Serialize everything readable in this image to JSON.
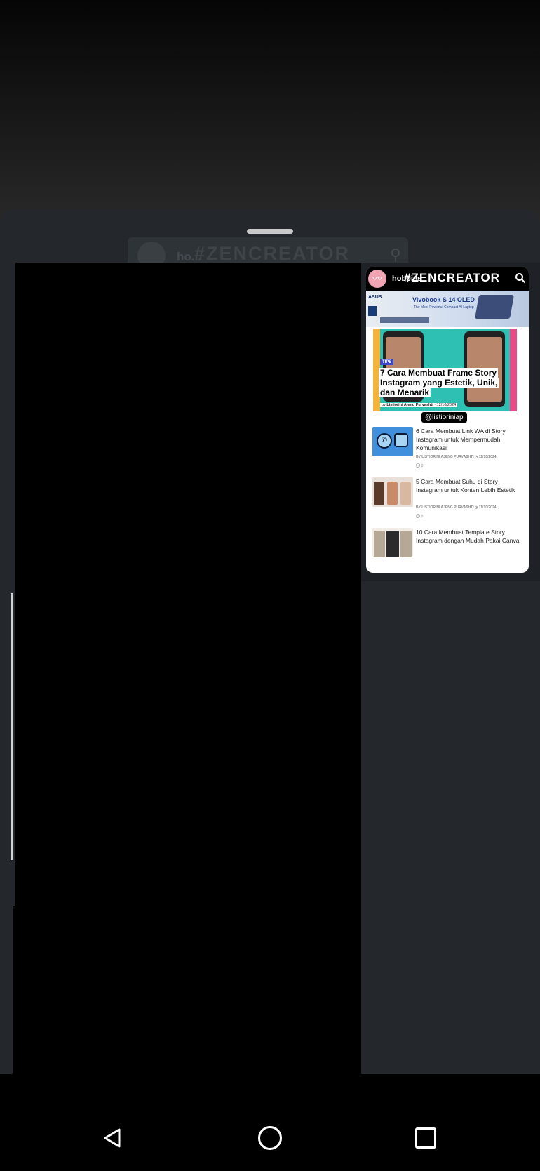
{
  "background": {
    "top_color": "#050505",
    "sheet_color": "#24282c"
  },
  "ghost_header": {
    "handle": "ho...",
    "title": "#ZENCREATOR"
  },
  "story": {
    "handle": "hobbies",
    "title": "#ZENCREATOR",
    "avatar_color": "#f1a4b4",
    "ad": {
      "brand": "ASUS",
      "title": "Vivobook S 14 OLED",
      "subtitle": "The Most Powerful Compact AI Laptop"
    },
    "hero": {
      "tag": "TIPS",
      "headline": "7 Cara Membuat Frame Story Instagram yang Estetik, Unik, dan Menarik",
      "author_prefix": "by",
      "author": "Listiorini Ajeng Purvashti",
      "date": "12/10/2024"
    },
    "mention": "@listioriniap",
    "articles": [
      {
        "title": "6 Cara Membuat Link WA di Story Instagram untuk Mempermudah Komunikasi",
        "byline": "BY LISTIORINI AJENG PURVASHTI",
        "date": "11/10/2024",
        "comments": "0"
      },
      {
        "title": "5 Cara Membuat Suhu di Story Instagram untuk Konten Lebih Estetik",
        "byline": "BY LISTIORINI AJENG PURVASHTI",
        "date": "11/10/2024",
        "comments": "0"
      },
      {
        "title": "10 Cara Membuat Template Story Instagram dengan Mudah Pakai Canva",
        "byline": "",
        "date": "",
        "comments": ""
      }
    ]
  },
  "nav": {
    "back_icon": "triangle-back-icon",
    "home_icon": "circle-home-icon",
    "recents_icon": "square-recents-icon"
  }
}
